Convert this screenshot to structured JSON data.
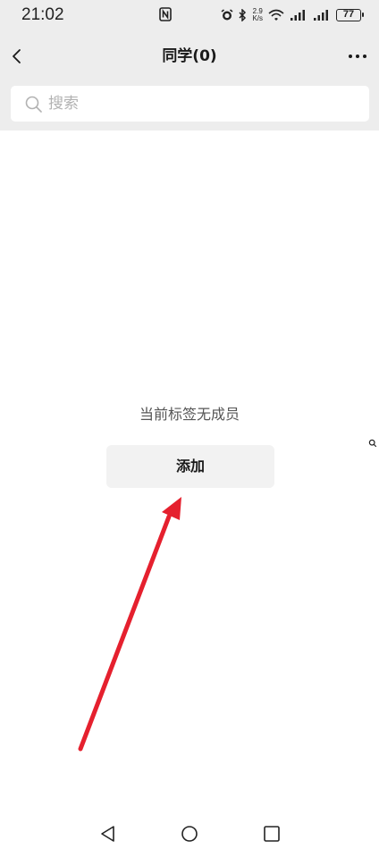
{
  "status_bar": {
    "time": "21:02",
    "net_speed_value": "2.9",
    "net_speed_unit": "K/s",
    "battery": "77"
  },
  "nav": {
    "title": "同学(0)"
  },
  "search": {
    "placeholder": "搜索"
  },
  "empty_state": {
    "message": "当前标签无成员",
    "add_button_label": "添加"
  },
  "icons": {
    "back": "chevron-left-icon",
    "more": "more-dots-icon",
    "search": "search-icon",
    "nfc": "nfc-icon",
    "alarm": "alarm-icon",
    "bluetooth": "bluetooth-icon",
    "wifi": "wifi-icon",
    "signal": "signal-icon"
  },
  "colors": {
    "header_bg": "#ededed",
    "annotation_arrow": "#e5202e"
  }
}
